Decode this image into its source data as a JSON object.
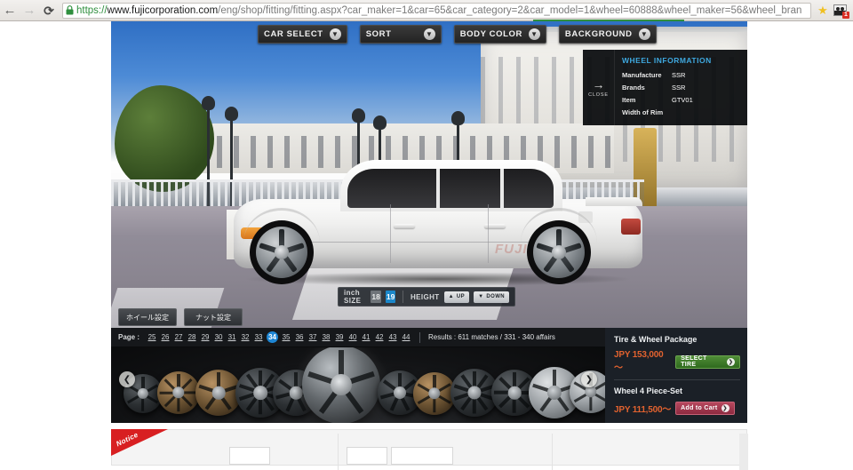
{
  "browser": {
    "back_icon": "back-arrow-icon",
    "forward_icon": "forward-arrow-icon",
    "reload_icon": "reload-icon",
    "lock_icon": "lock-icon",
    "url_scheme": "https://",
    "url_host": "www.fujicorporation.com",
    "url_rest": "/eng/shop/fitting/fitting.aspx?car_maker=1&car=65&car_category=2&car_model=1&wheel=60888&wheel_maker=56&wheel_bran",
    "bookmark_icon": "star-icon",
    "extension_icon": "extension-icon",
    "extension_badge": "1"
  },
  "viewer": {
    "top_buttons": [
      {
        "label": "CAR SELECT",
        "icon": "chevron-down-icon",
        "name": "car-select-button"
      },
      {
        "label": "SORT",
        "icon": "chevron-down-icon",
        "name": "sort-button"
      },
      {
        "label": "BODY COLOR",
        "icon": "chevron-down-icon",
        "name": "body-color-button"
      },
      {
        "label": "BACKGROUND",
        "icon": "chevron-down-icon",
        "name": "background-button"
      }
    ],
    "car_watermark": "FUJI"
  },
  "wheel_info": {
    "close_arrow": "→",
    "close_label": "CLOSE",
    "title": "WHEEL INFORMATION",
    "rows": [
      {
        "key": "Manufacture",
        "value": "SSR"
      },
      {
        "key": "Brands",
        "value": "SSR"
      },
      {
        "key": "Item",
        "value": "GTV01"
      },
      {
        "key": "Width of Rim",
        "value": ""
      }
    ]
  },
  "size_control": {
    "size_label": "inch SIZE",
    "sizes": [
      {
        "value": "18",
        "selected": false
      },
      {
        "value": "19",
        "selected": true
      }
    ],
    "height_label": "HEIGHT",
    "up_label": "UP",
    "up_icon": "triangle-up-icon",
    "down_label": "DOWN",
    "down_icon": "triangle-down-icon"
  },
  "setting_buttons": [
    {
      "label": "ホイール設定",
      "name": "wheel-setting-button"
    },
    {
      "label": "ナット設定",
      "name": "nut-setting-button"
    }
  ],
  "pager": {
    "label": "Page :",
    "pages": [
      "25",
      "26",
      "27",
      "28",
      "29",
      "30",
      "31",
      "32",
      "33",
      "34",
      "35",
      "36",
      "37",
      "38",
      "39",
      "40",
      "41",
      "42",
      "43",
      "44"
    ],
    "active_page": "34",
    "results": "Results : 611 matches / 331 - 340 affairs"
  },
  "carousel": {
    "prev_icon": "chevron-left-icon",
    "next_icon": "chevron-right-icon",
    "thumbnails": [
      {
        "style": "dark",
        "name": "wheel-thumb-1"
      },
      {
        "style": "bronze",
        "name": "wheel-thumb-2"
      },
      {
        "style": "bronze",
        "name": "wheel-thumb-3"
      },
      {
        "style": "dark",
        "name": "wheel-thumb-4"
      },
      {
        "style": "dark",
        "name": "wheel-thumb-5"
      },
      {
        "style": "dark",
        "name": "wheel-thumb-6"
      },
      {
        "style": "dark",
        "name": "wheel-thumb-7"
      },
      {
        "style": "bronze",
        "name": "wheel-thumb-8"
      },
      {
        "style": "dark",
        "name": "wheel-thumb-9"
      },
      {
        "style": "dark",
        "name": "wheel-thumb-10"
      },
      {
        "style": "silver",
        "name": "wheel-thumb-11"
      },
      {
        "style": "silver",
        "name": "wheel-thumb-12"
      }
    ]
  },
  "price_panel": {
    "package_title": "Tire & Wheel Package",
    "package_price": "JPY 153,000～",
    "package_button": "SELECT TIRE",
    "wheel_title": "Wheel 4 Piece-Set",
    "wheel_price": "JPY 111,500～",
    "wheel_button": "Add to Cart",
    "arrow_icon": "chevron-right-icon"
  },
  "lower": {
    "notice_label": "Notice"
  },
  "colors": {
    "accent_blue": "#1e86d4",
    "info_title_blue": "#3fa9e0",
    "price_orange": "#e2622f",
    "select_tire_green": "#4f8c37",
    "add_cart_red": "#b7485e",
    "notice_red": "#d81f21",
    "app_background": "#111214"
  }
}
